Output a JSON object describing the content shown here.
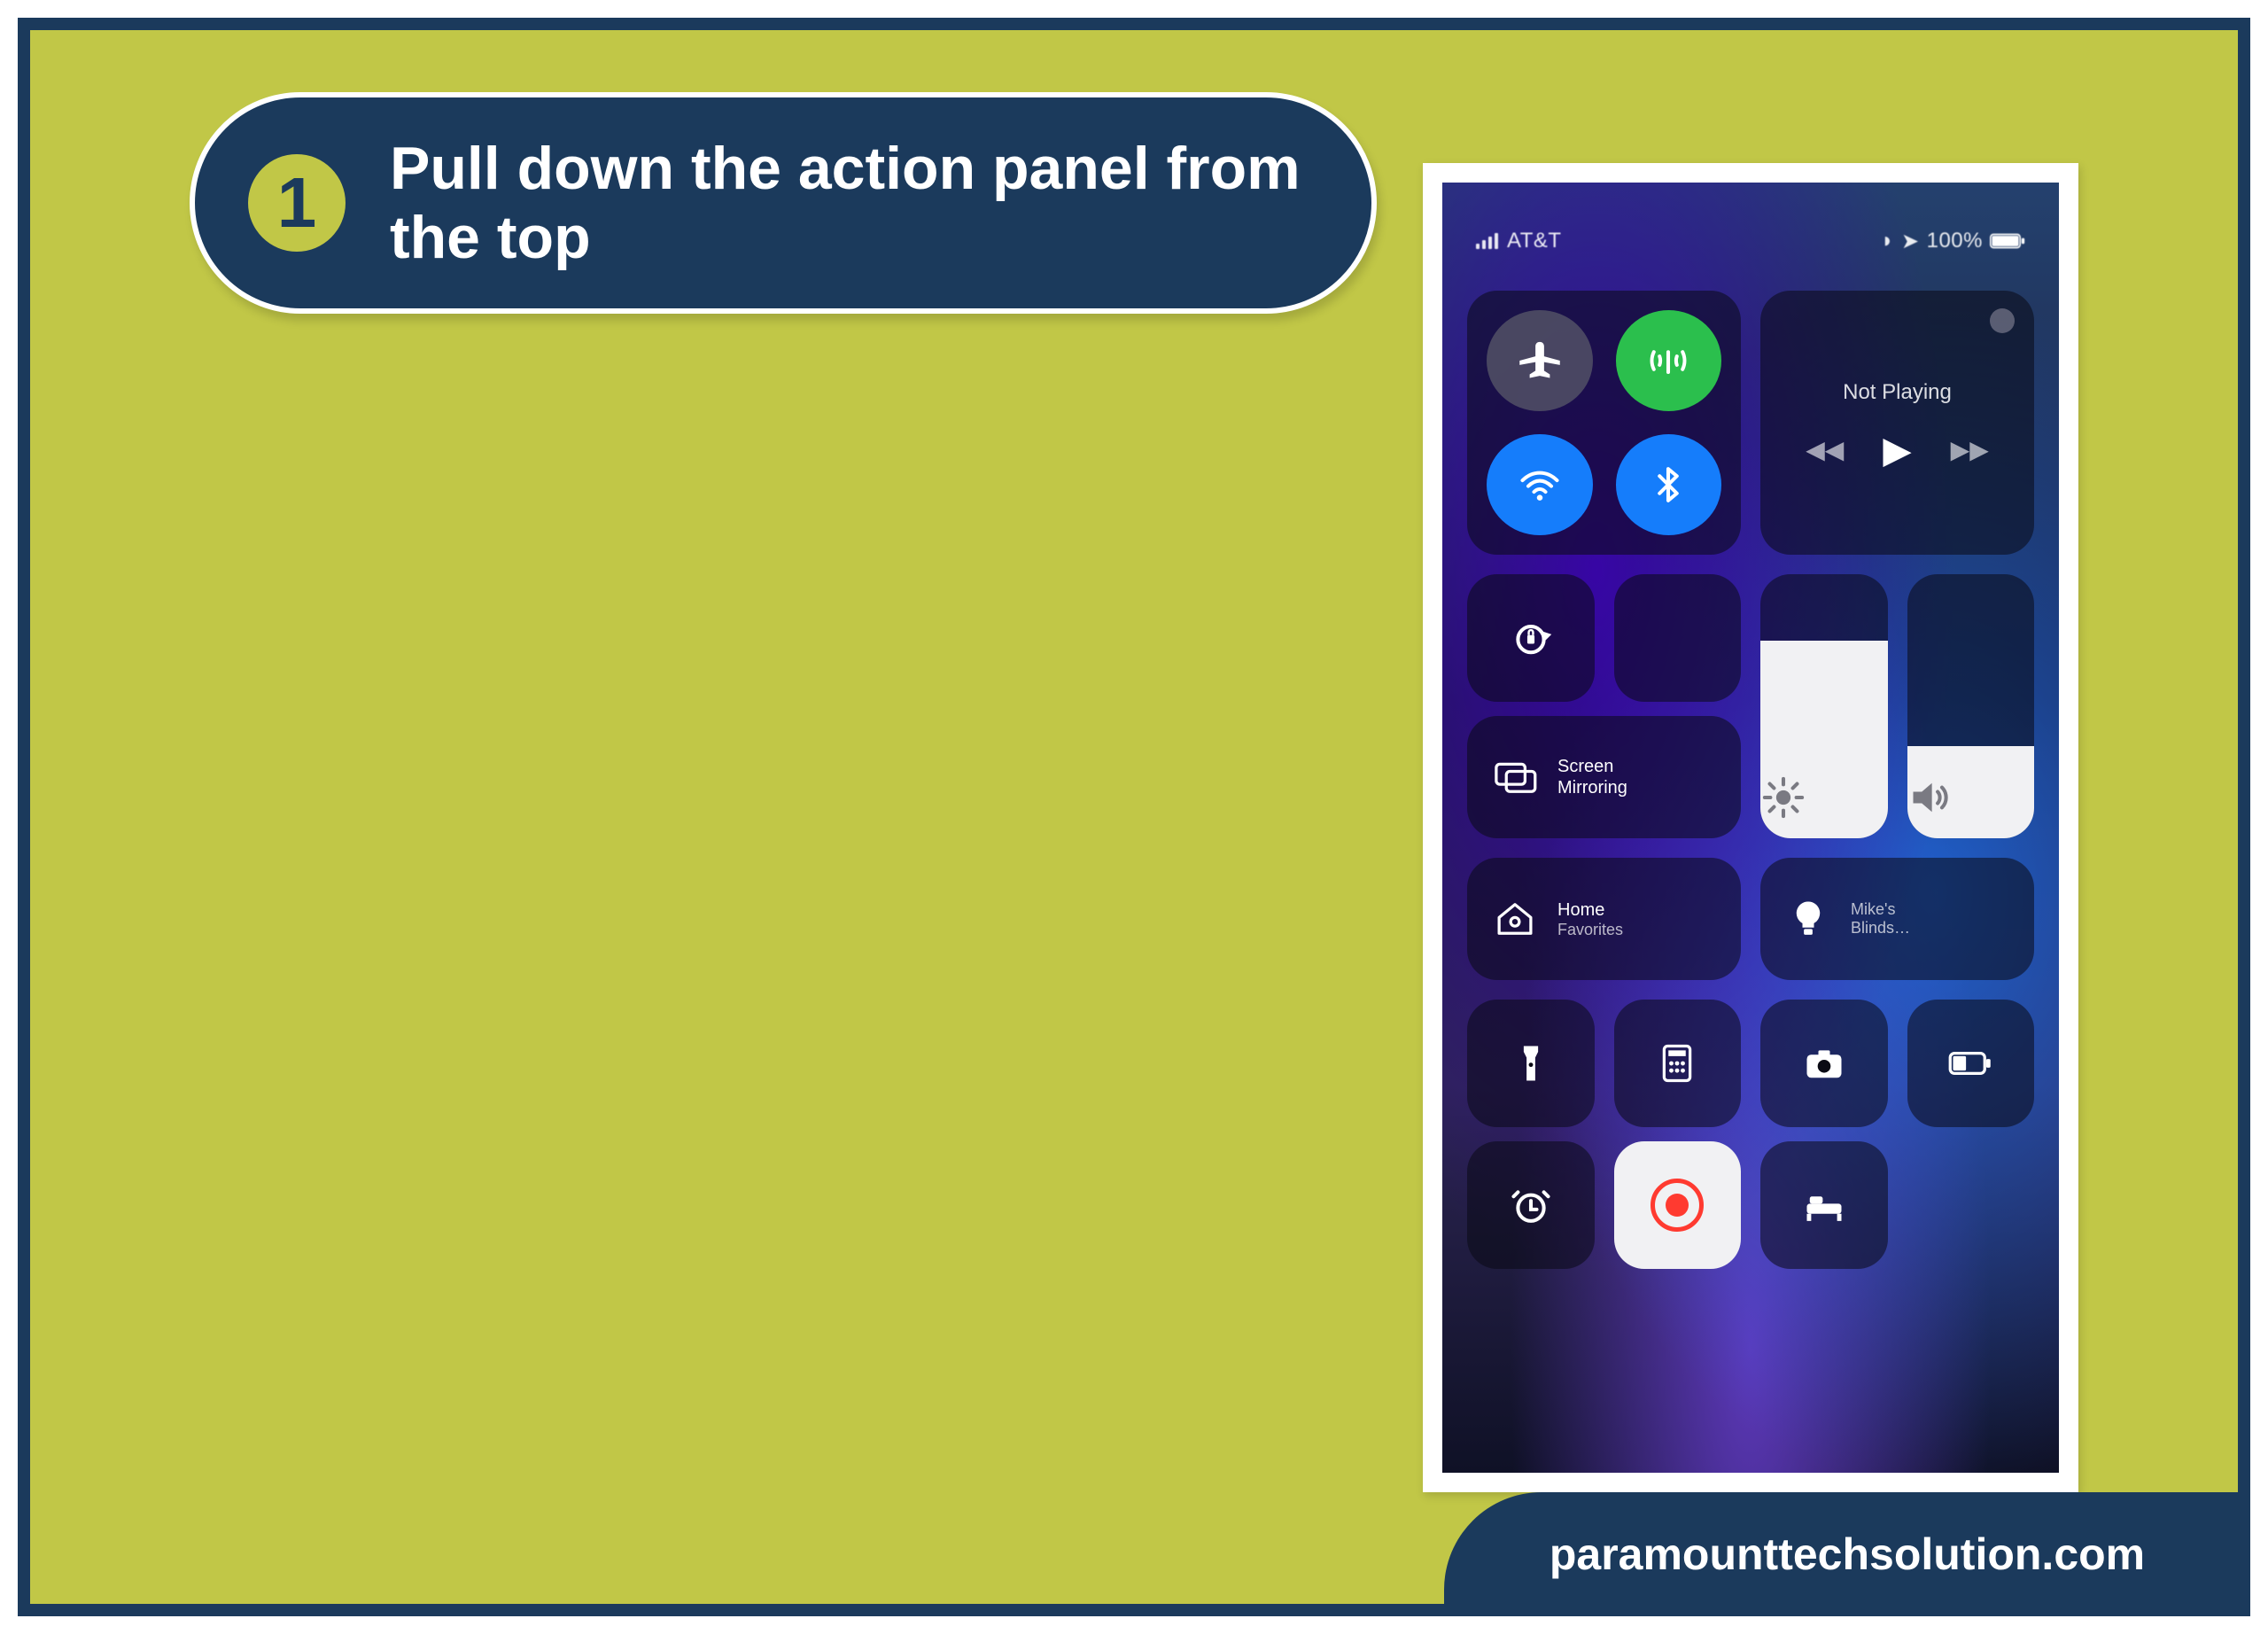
{
  "step": {
    "number": "1",
    "text": "Pull down the action panel from the top"
  },
  "banner": {
    "url": "paramounttechsolution.com"
  },
  "phone": {
    "statusbar": {
      "carrier": "AT&T",
      "battery": "100%"
    },
    "media": {
      "title": "Not Playing"
    },
    "screen_mirroring": {
      "label1": "Screen",
      "label2": "Mirroring"
    },
    "home_favorites": {
      "label1": "Home",
      "label2": "Favorites"
    },
    "smart_devices": {
      "label1": "Mike's",
      "label2": "Blinds…"
    },
    "brightness_pct": 75,
    "volume_pct": 35
  }
}
